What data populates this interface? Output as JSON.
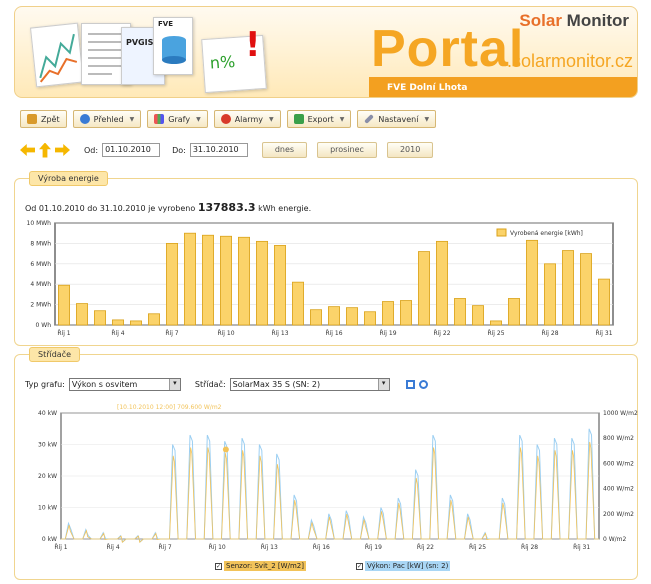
{
  "header": {
    "brand_accent": "Solar",
    "brand_rest": " Monitor",
    "portal": "Portal",
    "domain": ".solarmonitor.cz",
    "site": "FVE Dolní Lhota",
    "thumb_labels": [
      "PVGIS",
      "FVE",
      "n%",
      "!"
    ]
  },
  "toolbar": {
    "back": "Zpět",
    "overview": "Přehled",
    "charts": "Grafy",
    "alarms": "Alarmy",
    "export": "Export",
    "settings": "Nastavení"
  },
  "dates": {
    "from_label": "Od:",
    "from_value": "01.10.2010",
    "to_label": "Do:",
    "to_value": "31.10.2010",
    "today": "dnes",
    "month": "prosinec",
    "year": "2010"
  },
  "energy_panel": {
    "tab": "Výroba energie",
    "summary_prefix": "Od 01.10.2010 do 31.10.2010 je vyrobeno",
    "summary_value": "137883.3",
    "summary_suffix": "kWh energie."
  },
  "inverter_panel": {
    "tab": "Střídače",
    "chart_type_label": "Typ grafu:",
    "chart_type_value": "Výkon s osvitem",
    "inverter_label": "Střídač:",
    "inverter_value": "SolarMax 35 S (SN: 2)",
    "tooltip": "[10.10.2010 12:00] 709.600 W/m2",
    "legend_sensor": "Senzor: Svit_2 [W/m2]",
    "legend_power": "Výkon: Pac [kW] (sn: 2)"
  },
  "colors": {
    "accent": "#f5a623",
    "bar_fill": "#fbd36a",
    "bar_stroke": "#d9a21a",
    "power": "#9ccff2",
    "sensor": "#f2c35a"
  },
  "chart_data": [
    {
      "type": "bar",
      "categories": [
        "Říj 1",
        "2",
        "3",
        "Říj 4",
        "5",
        "6",
        "Říj 7",
        "8",
        "9",
        "Říj 10",
        "11",
        "12",
        "Říj 13",
        "14",
        "15",
        "Říj 16",
        "17",
        "18",
        "Říj 19",
        "20",
        "21",
        "Říj 22",
        "23",
        "24",
        "Říj 25",
        "26",
        "27",
        "Říj 28",
        "29",
        "30",
        "Říj 31"
      ],
      "values": [
        3.9,
        2.1,
        1.4,
        0.5,
        0.4,
        1.1,
        8.0,
        9.0,
        8.8,
        8.7,
        8.6,
        8.2,
        7.8,
        4.2,
        1.5,
        1.8,
        1.7,
        1.3,
        2.3,
        2.4,
        7.2,
        8.2,
        2.6,
        1.9,
        0.4,
        2.6,
        8.3,
        6.0,
        7.3,
        7.0,
        4.5
      ],
      "xticks": [
        "Říj 1",
        "Říj 4",
        "Říj 7",
        "Říj 10",
        "Říj 13",
        "Říj 16",
        "Říj 19",
        "Říj 22",
        "Říj 25",
        "Říj 28",
        "Říj 31"
      ],
      "yticks": [
        "0 Wh",
        "2 MWh",
        "4 MWh",
        "6 MWh",
        "8 MWh",
        "10 MWh"
      ],
      "ylim": [
        0,
        10
      ],
      "legend": "Vyrobená energie [kWh]",
      "legend_position": "top-right"
    },
    {
      "type": "line",
      "xticks": [
        "Říj 1",
        "Říj 4",
        "Říj 7",
        "Říj 10",
        "Říj 13",
        "Říj 16",
        "Říj 19",
        "Říj 22",
        "Říj 25",
        "Říj 28",
        "Říj 31"
      ],
      "yticks_left": [
        "0 kW",
        "10 kW",
        "20 kW",
        "30 kW",
        "40 kW"
      ],
      "yticks_right": [
        "0 W/m2",
        "200 W/m2",
        "400 W/m2",
        "600 W/m2",
        "800 W/m2",
        "1000 W/m2"
      ],
      "ylim_left": [
        0,
        40
      ],
      "ylim_right": [
        0,
        1000
      ],
      "daily_peaks_kw": [
        5,
        3,
        2,
        1,
        1,
        2,
        30,
        33,
        33,
        31,
        32,
        30,
        27,
        14,
        6,
        8,
        9,
        7,
        10,
        13,
        22,
        33,
        14,
        8,
        2,
        13,
        33,
        30,
        32,
        32,
        35
      ],
      "series": [
        {
          "name": "Senzor: Svit_2 [W/m2]",
          "axis": "right"
        },
        {
          "name": "Výkon: Pac [kW] (sn: 2)",
          "axis": "left"
        }
      ]
    }
  ]
}
